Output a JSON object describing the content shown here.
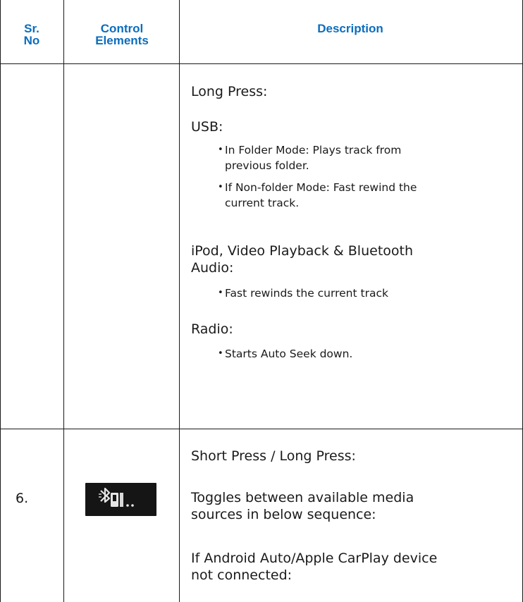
{
  "table": {
    "headers": {
      "sr_no": [
        "Sr.",
        "No"
      ],
      "control_elements": [
        "Control",
        "Elements"
      ],
      "description": "Description"
    },
    "row_continued": {
      "sr_no": "",
      "description": {
        "long_press_heading": "Long Press:",
        "usb_heading": "USB:",
        "usb_bullets": [
          [
            "In Folder Mode: Plays track from",
            "previous folder."
          ],
          [
            "If Non-folder Mode: Fast rewind the",
            "current track."
          ]
        ],
        "ipod_heading": [
          "iPod, Video Playback & Bluetooth",
          "Audio:"
        ],
        "ipod_bullets": [
          "Fast rewinds the current track"
        ],
        "radio_heading": "Radio:",
        "radio_bullets": [
          "Starts Auto Seek down."
        ]
      }
    },
    "row_6": {
      "sr_no": "6.",
      "control_icon": "bluetooth-media-source-icon",
      "description": {
        "press_heading": "Short Press / Long Press:",
        "toggle_text": [
          "Toggles between available media",
          "sources in below sequence:"
        ],
        "condition_text": [
          "If Android Auto/Apple CarPlay device",
          "not connected:"
        ]
      }
    }
  }
}
